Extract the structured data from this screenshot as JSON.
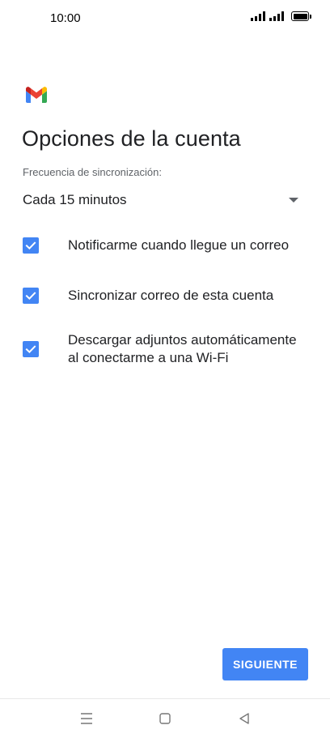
{
  "status_bar": {
    "time": "10:00"
  },
  "app": {
    "logo_icon": "gmail-logo-icon",
    "colors": {
      "accent": "#4285f4",
      "gmail_red": "#ea4335",
      "gmail_blue": "#4285f4",
      "gmail_green": "#34a853",
      "gmail_yellow": "#fbbc04"
    }
  },
  "page": {
    "title": "Opciones de la cuenta"
  },
  "sync": {
    "label": "Frecuencia de sincronización:",
    "selected_value": "Cada 15 minutos"
  },
  "options": [
    {
      "label": "Notificarme cuando llegue un correo",
      "checked": true
    },
    {
      "label": "Sincronizar correo de esta cuenta",
      "checked": true
    },
    {
      "label": "Descargar adjuntos automáticamente al conectarme a una Wi-Fi",
      "checked": true
    }
  ],
  "actions": {
    "next_label": "SIGUIENTE"
  },
  "nav_bar": {
    "icons": [
      "menu-icon",
      "home-icon",
      "back-icon"
    ]
  }
}
